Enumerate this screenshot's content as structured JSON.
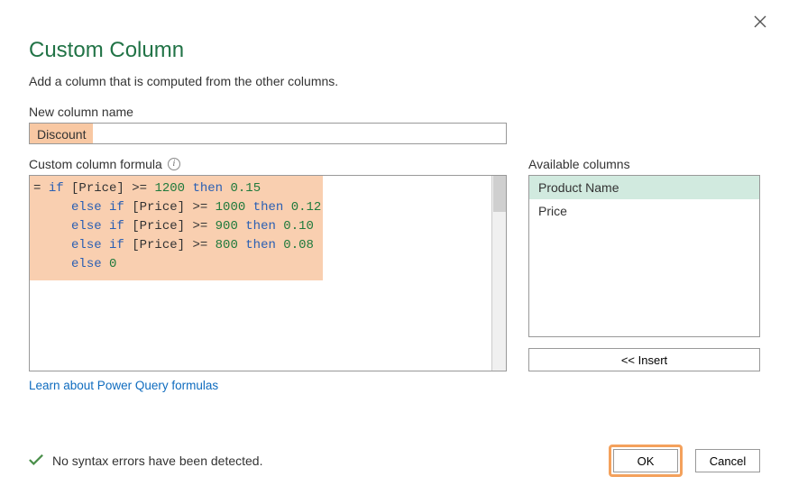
{
  "dialog": {
    "title": "Custom Column",
    "subtitle": "Add a column that is computed from the other columns."
  },
  "column_name": {
    "label": "New column name",
    "value": "Discount"
  },
  "formula": {
    "label": "Custom column formula",
    "tokens": [
      [
        {
          "t": "txt",
          "v": "= "
        },
        {
          "t": "kw",
          "v": "if"
        },
        {
          "t": "txt",
          "v": " [Price] >= "
        },
        {
          "t": "num",
          "v": "1200"
        },
        {
          "t": "txt",
          "v": " "
        },
        {
          "t": "kw",
          "v": "then"
        },
        {
          "t": "txt",
          "v": " "
        },
        {
          "t": "num",
          "v": "0.15"
        }
      ],
      [
        {
          "t": "txt",
          "v": "     "
        },
        {
          "t": "kw",
          "v": "else if"
        },
        {
          "t": "txt",
          "v": " [Price] >= "
        },
        {
          "t": "num",
          "v": "1000"
        },
        {
          "t": "txt",
          "v": " "
        },
        {
          "t": "kw",
          "v": "then"
        },
        {
          "t": "txt",
          "v": " "
        },
        {
          "t": "num",
          "v": "0.12"
        }
      ],
      [
        {
          "t": "txt",
          "v": "     "
        },
        {
          "t": "kw",
          "v": "else if"
        },
        {
          "t": "txt",
          "v": " [Price] >= "
        },
        {
          "t": "num",
          "v": "900"
        },
        {
          "t": "txt",
          "v": " "
        },
        {
          "t": "kw",
          "v": "then"
        },
        {
          "t": "txt",
          "v": " "
        },
        {
          "t": "num",
          "v": "0.10"
        }
      ],
      [
        {
          "t": "txt",
          "v": "     "
        },
        {
          "t": "kw",
          "v": "else if"
        },
        {
          "t": "txt",
          "v": " [Price] >= "
        },
        {
          "t": "num",
          "v": "800"
        },
        {
          "t": "txt",
          "v": " "
        },
        {
          "t": "kw",
          "v": "then"
        },
        {
          "t": "txt",
          "v": " "
        },
        {
          "t": "num",
          "v": "0.08"
        }
      ],
      [
        {
          "t": "txt",
          "v": "     "
        },
        {
          "t": "kw",
          "v": "else"
        },
        {
          "t": "txt",
          "v": " "
        },
        {
          "t": "num",
          "v": "0"
        }
      ]
    ]
  },
  "learn_link": "Learn about Power Query formulas",
  "available": {
    "label": "Available columns",
    "items": [
      "Product Name",
      "Price"
    ],
    "selected_index": 0,
    "insert_label": "<< Insert"
  },
  "status": {
    "text": "No syntax errors have been detected."
  },
  "buttons": {
    "ok": "OK",
    "cancel": "Cancel"
  }
}
